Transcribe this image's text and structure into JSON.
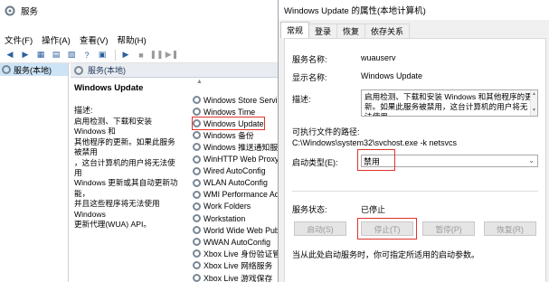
{
  "services_window": {
    "title": "服务",
    "menu": [
      "文件(F)",
      "操作(A)",
      "查看(V)",
      "帮助(H)"
    ],
    "tree_item": "服务(本地)",
    "header": "服务(本地)",
    "detail": {
      "title": "Windows Update",
      "desc_label": "描述:",
      "desc_lines": [
        "启用检测、下载和安装 Windows 和",
        "其他程序的更新。如果此服务被禁用",
        "，这台计算机的用户将无法使用",
        "Windows 更新或其自动更新功能，",
        "并且这些程序将无法使用 Windows",
        "更新代理(WUA) API。"
      ]
    },
    "services": [
      "Windows Store Service",
      "Windows Time",
      "Windows Update",
      "Windows 备份",
      "Windows 推送通知服务",
      "WinHTTP Web Proxy Au",
      "Wired AutoConfig",
      "WLAN AutoConfig",
      "WMI Performance Ada",
      "Work Folders",
      "Workstation",
      "World Wide Web Publi",
      "WWAN AutoConfig",
      "Xbox Live 身份验证管理",
      "Xbox Live 网络服务",
      "Xbox Live 游戏保存"
    ],
    "selected_index": 2
  },
  "dialog": {
    "title": "Windows Update 的属性(本地计算机)",
    "tabs": [
      "常规",
      "登录",
      "恢复",
      "依存关系"
    ],
    "active_tab": 0,
    "service_name_label": "服务名称:",
    "service_name": "wuauserv",
    "display_name_label": "显示名称:",
    "display_name": "Windows Update",
    "description_label": "描述:",
    "description": "启用检测、下载和安装 Windows 和其他程序的更新。如果此服务被禁用，这台计算机的用户将无法使用",
    "exe_path_label": "可执行文件的路径:",
    "exe_path": "C:\\Windows\\system32\\svchost.exe -k netsvcs",
    "startup_type_label": "启动类型(E):",
    "startup_type": "禁用",
    "status_label": "服务状态:",
    "status": "已停止",
    "buttons": {
      "start": "启动(S)",
      "stop": "停止(T)",
      "pause": "暂停(P)",
      "resume": "恢复(R)"
    },
    "start_params_hint": "当从此处启动服务时，你可指定所适用的启动参数。"
  },
  "colors": {
    "highlight_red": "#e0332c",
    "selection_blue": "#cde4f7"
  }
}
